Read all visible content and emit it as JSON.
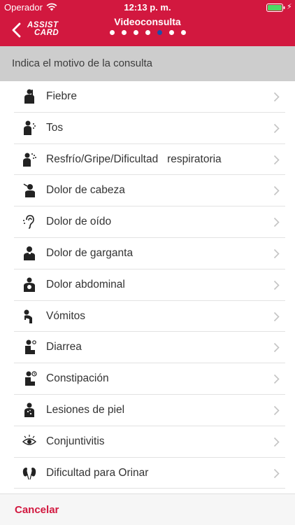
{
  "status_bar": {
    "carrier": "Operador",
    "time": "12:13 p. m."
  },
  "nav": {
    "title": "Videoconsulta",
    "logo_line1": "ASSIST",
    "logo_line2": "CARD",
    "steps_total": 7,
    "step_current": 5
  },
  "section": {
    "title": "Indica el motivo de la consulta"
  },
  "reasons": [
    {
      "label": "Fiebre",
      "icon": "fever-icon"
    },
    {
      "label": "Tos",
      "icon": "cough-icon"
    },
    {
      "label": "Resfrío/Gripe/Dificultad   respiratoria",
      "icon": "cold-flu-icon"
    },
    {
      "label": "Dolor de cabeza",
      "icon": "headache-icon"
    },
    {
      "label": "Dolor de oído",
      "icon": "ear-icon"
    },
    {
      "label": "Dolor de garganta",
      "icon": "throat-icon"
    },
    {
      "label": "Dolor abdominal",
      "icon": "abdominal-pain-icon"
    },
    {
      "label": "Vómitos",
      "icon": "vomiting-icon"
    },
    {
      "label": "Diarrea",
      "icon": "diarrhea-icon"
    },
    {
      "label": "Constipación",
      "icon": "constipation-icon"
    },
    {
      "label": "Lesiones de piel",
      "icon": "skin-lesion-icon"
    },
    {
      "label": "Conjuntivitis",
      "icon": "eye-icon"
    },
    {
      "label": "Dificultad para Orinar",
      "icon": "kidney-icon"
    }
  ],
  "footer": {
    "cancel_label": "Cancelar"
  },
  "colors": {
    "brand": "#d2183f",
    "active_dot": "#1d4ea8",
    "section_bg": "#cdcdcd"
  }
}
